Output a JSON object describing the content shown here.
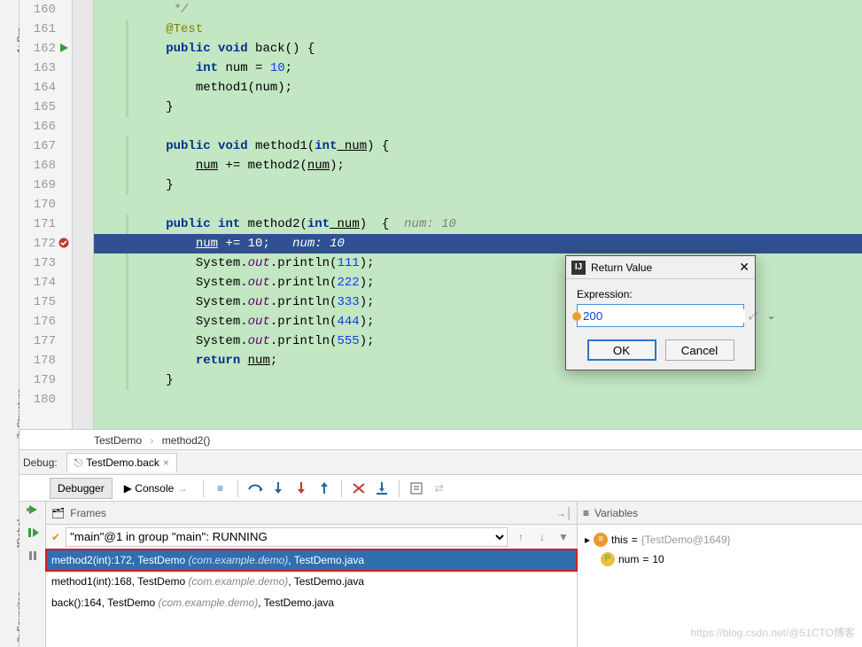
{
  "sidebar": {
    "project": "1: Pro...",
    "structure": "7: Structure",
    "jrebel": "JRebel",
    "favorites": "2: Favorites"
  },
  "gutter": [
    "160",
    "161",
    "162",
    "163",
    "164",
    "165",
    "166",
    "167",
    "168",
    "169",
    "170",
    "171",
    "172",
    "173",
    "174",
    "175",
    "176",
    "177",
    "178",
    "179",
    "180"
  ],
  "code": {
    "l160": "         */",
    "ann": "@Test",
    "back_sig": {
      "pub": "public",
      "void": "void",
      "name": " back() {"
    },
    "num_decl": {
      "int": "int",
      "rest": " num = ",
      "val": "10",
      "semi": ";"
    },
    "call_m1": "method1(num);",
    "close": "}",
    "m1_sig": {
      "pub": "public",
      "void": "void",
      "name": " method1(",
      "int": "int",
      "arg": " num",
      ")": ") {"
    },
    "m1_body_a": "num",
    " m1_body_b": " += method2(",
    "m1_body_c": "num",
    "m1_body_d": ");",
    "m2_sig": {
      "pub": "public",
      "int": "int",
      "name": " method2(",
      "pint": "int",
      "arg": " num",
      ")": ")  {  "
    },
    "m2_hint": "num: 10",
    "hl": {
      "a": "num",
      "b": " += ",
      "c": "10",
      "d": ";   "
    },
    "hl_hint": "num: 10",
    "p111": {
      "pre": "System.",
      "out": "out",
      "mid": ".println(",
      "v": "111",
      "post": ");"
    },
    "p222": {
      "pre": "System.",
      "out": "out",
      "mid": ".println(",
      "v": "222",
      "post": ");"
    },
    "p333": {
      "pre": "System.",
      "out": "out",
      "mid": ".println(",
      "v": "333",
      "post": ");"
    },
    "p444": {
      "pre": "System.",
      "out": "out",
      "mid": ".println(",
      "v": "444",
      "post": ");"
    },
    "p555": {
      "pre": "System.",
      "out": "out",
      "mid": ".println(",
      "v": "555",
      "post": ");"
    },
    "ret": {
      "kw": "return",
      "sp": " ",
      "v": "num",
      "semi": ";"
    }
  },
  "breadcrumb": {
    "a": "TestDemo",
    "b": "method2()"
  },
  "debug": {
    "label": "Debug:",
    "tab": "TestDemo.back"
  },
  "subtabs": {
    "debugger": "Debugger",
    "console": "Console",
    "arrow": "→"
  },
  "frames": {
    "title": "Frames",
    "thread": "\"main\"@1 in group \"main\": RUNNING",
    "rows": [
      {
        "m": "method2(int):172, TestDemo ",
        "pkg": "(com.example.demo)",
        "f": ", TestDemo.java"
      },
      {
        "m": "method1(int):168, TestDemo ",
        "pkg": "(com.example.demo)",
        "f": ", TestDemo.java"
      },
      {
        "m": "back():164, TestDemo ",
        "pkg": "(com.example.demo)",
        "f": ", TestDemo.java"
      }
    ]
  },
  "vars": {
    "title": "Variables",
    "this": {
      "n": "this",
      "eq": " = ",
      "v": "{TestDemo@1649}"
    },
    "num": {
      "n": "num",
      "eq": " = ",
      "v": "10"
    }
  },
  "dialog": {
    "title": "Return Value",
    "label": "Expression:",
    "value": "200",
    "ok": "OK",
    "cancel": "Cancel"
  },
  "watermark": "https://blog.csdn.net/@51CTO博客"
}
